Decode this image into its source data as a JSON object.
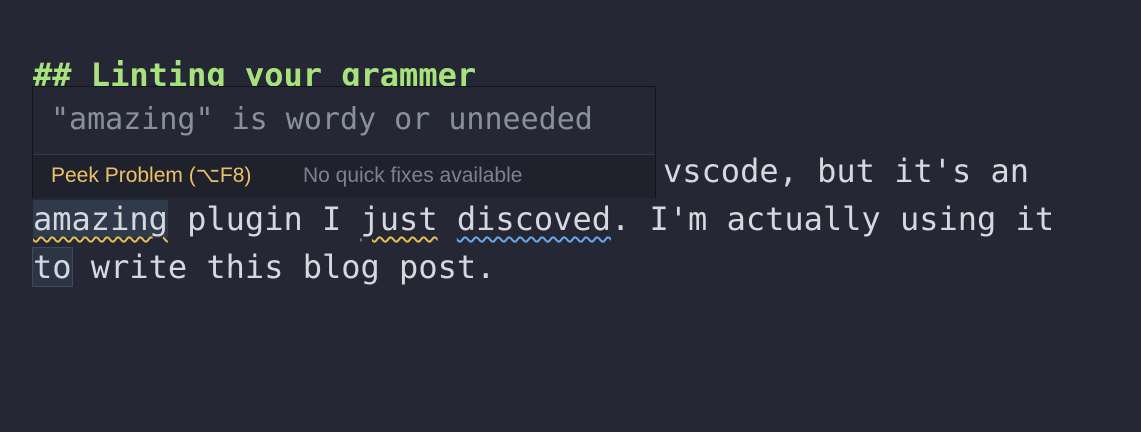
{
  "editor": {
    "heading": "## Linting your grammer",
    "line2_tail": "vscode, but it's an",
    "line3": {
      "word_amazing": "amazing",
      "seg1": " plugin I ",
      "word_just": "just",
      "seg2": " ",
      "word_discoved": "discoved",
      "seg3": ". I'm actually using it"
    },
    "line4": {
      "word_to": "to",
      "rest": " write this blog post."
    }
  },
  "hover": {
    "message": "\"amazing\" is wordy or unneeded",
    "peek_label": "Peek Problem (⌥F8)",
    "quick_fix_label": "No quick fixes available"
  },
  "colors": {
    "background": "#252834",
    "heading": "#a8e27d",
    "text": "#d5d8df",
    "warning_squiggle": "#e4bf55",
    "info_squiggle": "#6aa8ee",
    "peek_link": "#ecc265"
  }
}
